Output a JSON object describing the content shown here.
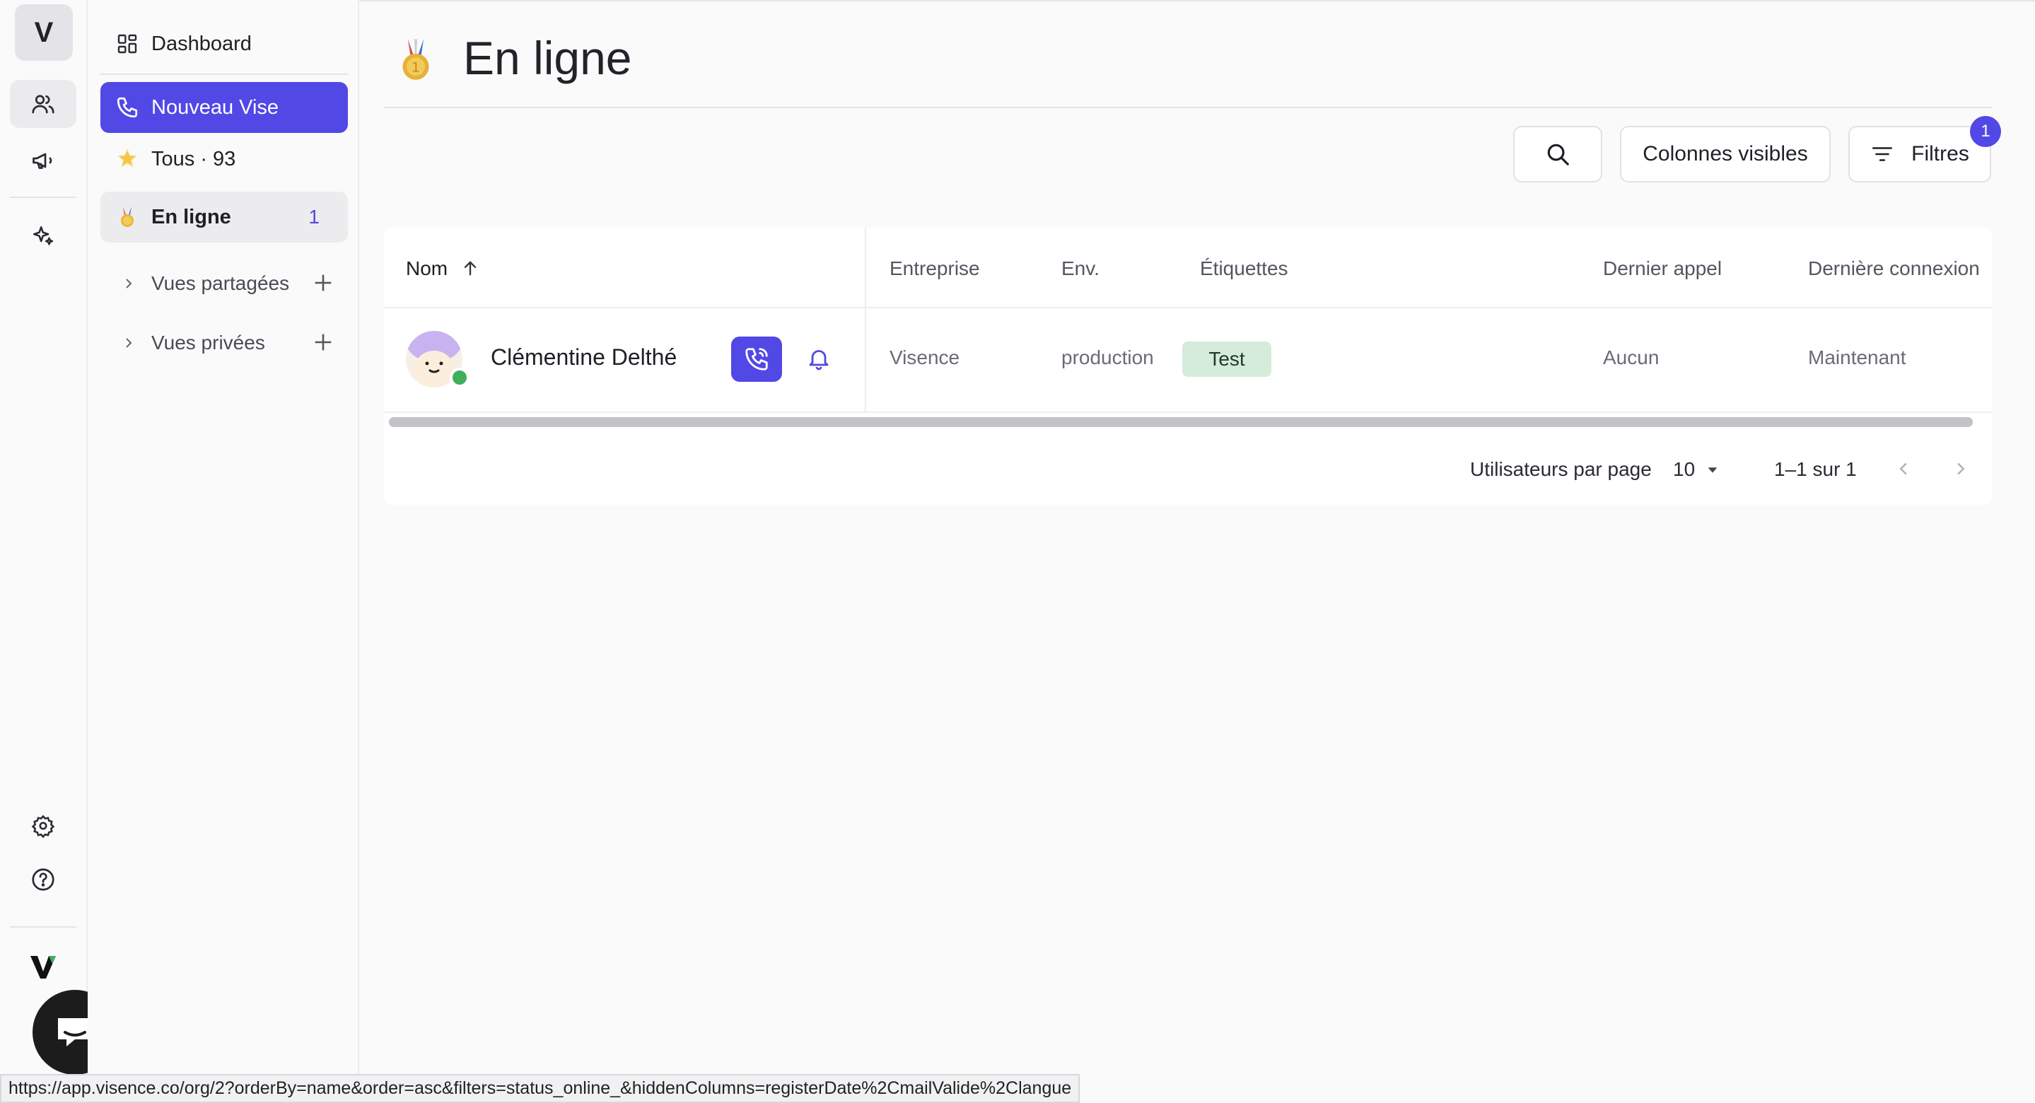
{
  "rail": {
    "workspace_initial": "V",
    "icons": [
      "users-icon",
      "megaphone-icon",
      "sparkles-icon",
      "gear-icon",
      "help-icon",
      "brand-logo-icon",
      "chat-icon"
    ]
  },
  "sidebar": {
    "dashboard_label": "Dashboard",
    "new_button_label": "Nouveau Vise",
    "views": [
      {
        "label": "Tous · 93",
        "icon": "star-icon"
      },
      {
        "label": "En ligne",
        "icon": "medal-icon",
        "count": "1"
      }
    ],
    "groups": [
      {
        "label": "Vues partagées"
      },
      {
        "label": "Vues privées"
      }
    ]
  },
  "page": {
    "title": "En ligne",
    "title_icon": "medal-icon"
  },
  "toolbar": {
    "columns_label": "Colonnes visibles",
    "filters_label": "Filtres",
    "filters_count": "1"
  },
  "table": {
    "headers": [
      "Nom",
      "Entreprise",
      "Env.",
      "Étiquettes",
      "Dernier appel",
      "Dernière connexion"
    ],
    "rows": [
      {
        "name": "Clémentine Delthé",
        "company": "Visence",
        "env": "production",
        "tag": "Test",
        "last_call": "Aucun",
        "last_login": "Maintenant",
        "status": "online"
      }
    ]
  },
  "pagination": {
    "per_page_label": "Utilisateurs par page",
    "per_page_value": "10",
    "range_text": "1–1 sur 1"
  },
  "status_url": "https://app.visence.co/org/2?orderBy=name&order=asc&filters=status_online_&hiddenColumns=registerDate%2CmailValide%2Clangue",
  "colors": {
    "accent": "#5248e5",
    "online": "#3fae5d",
    "tag_bg": "#d4ecd9"
  }
}
